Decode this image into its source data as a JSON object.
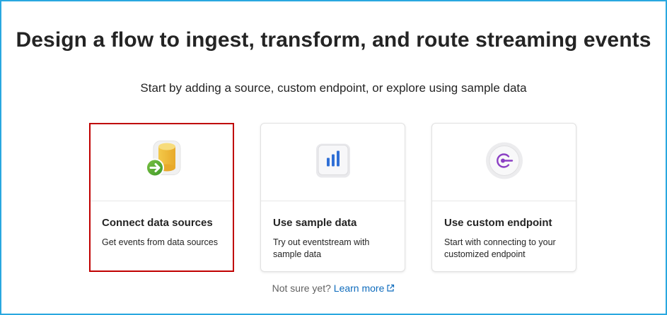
{
  "heading": "Design a flow to ingest, transform, and route streaming events",
  "subheading": "Start by adding a source, custom endpoint, or explore using sample data",
  "cards": [
    {
      "title": "Connect data sources",
      "description": "Get events from data sources",
      "icon": "database-connect-icon",
      "selected": true
    },
    {
      "title": "Use sample data",
      "description": "Try out eventstream with sample data",
      "icon": "bar-chart-icon",
      "selected": false
    },
    {
      "title": "Use custom endpoint",
      "description": "Start with connecting to your customized endpoint",
      "icon": "endpoint-icon",
      "selected": false
    }
  ],
  "footer": {
    "prompt": "Not sure yet?",
    "link_label": "Learn more",
    "link_icon": "external-link-icon"
  },
  "colors": {
    "frame_border": "#29a8e0",
    "selection_border": "#c00000",
    "link": "#0f6cbd"
  }
}
